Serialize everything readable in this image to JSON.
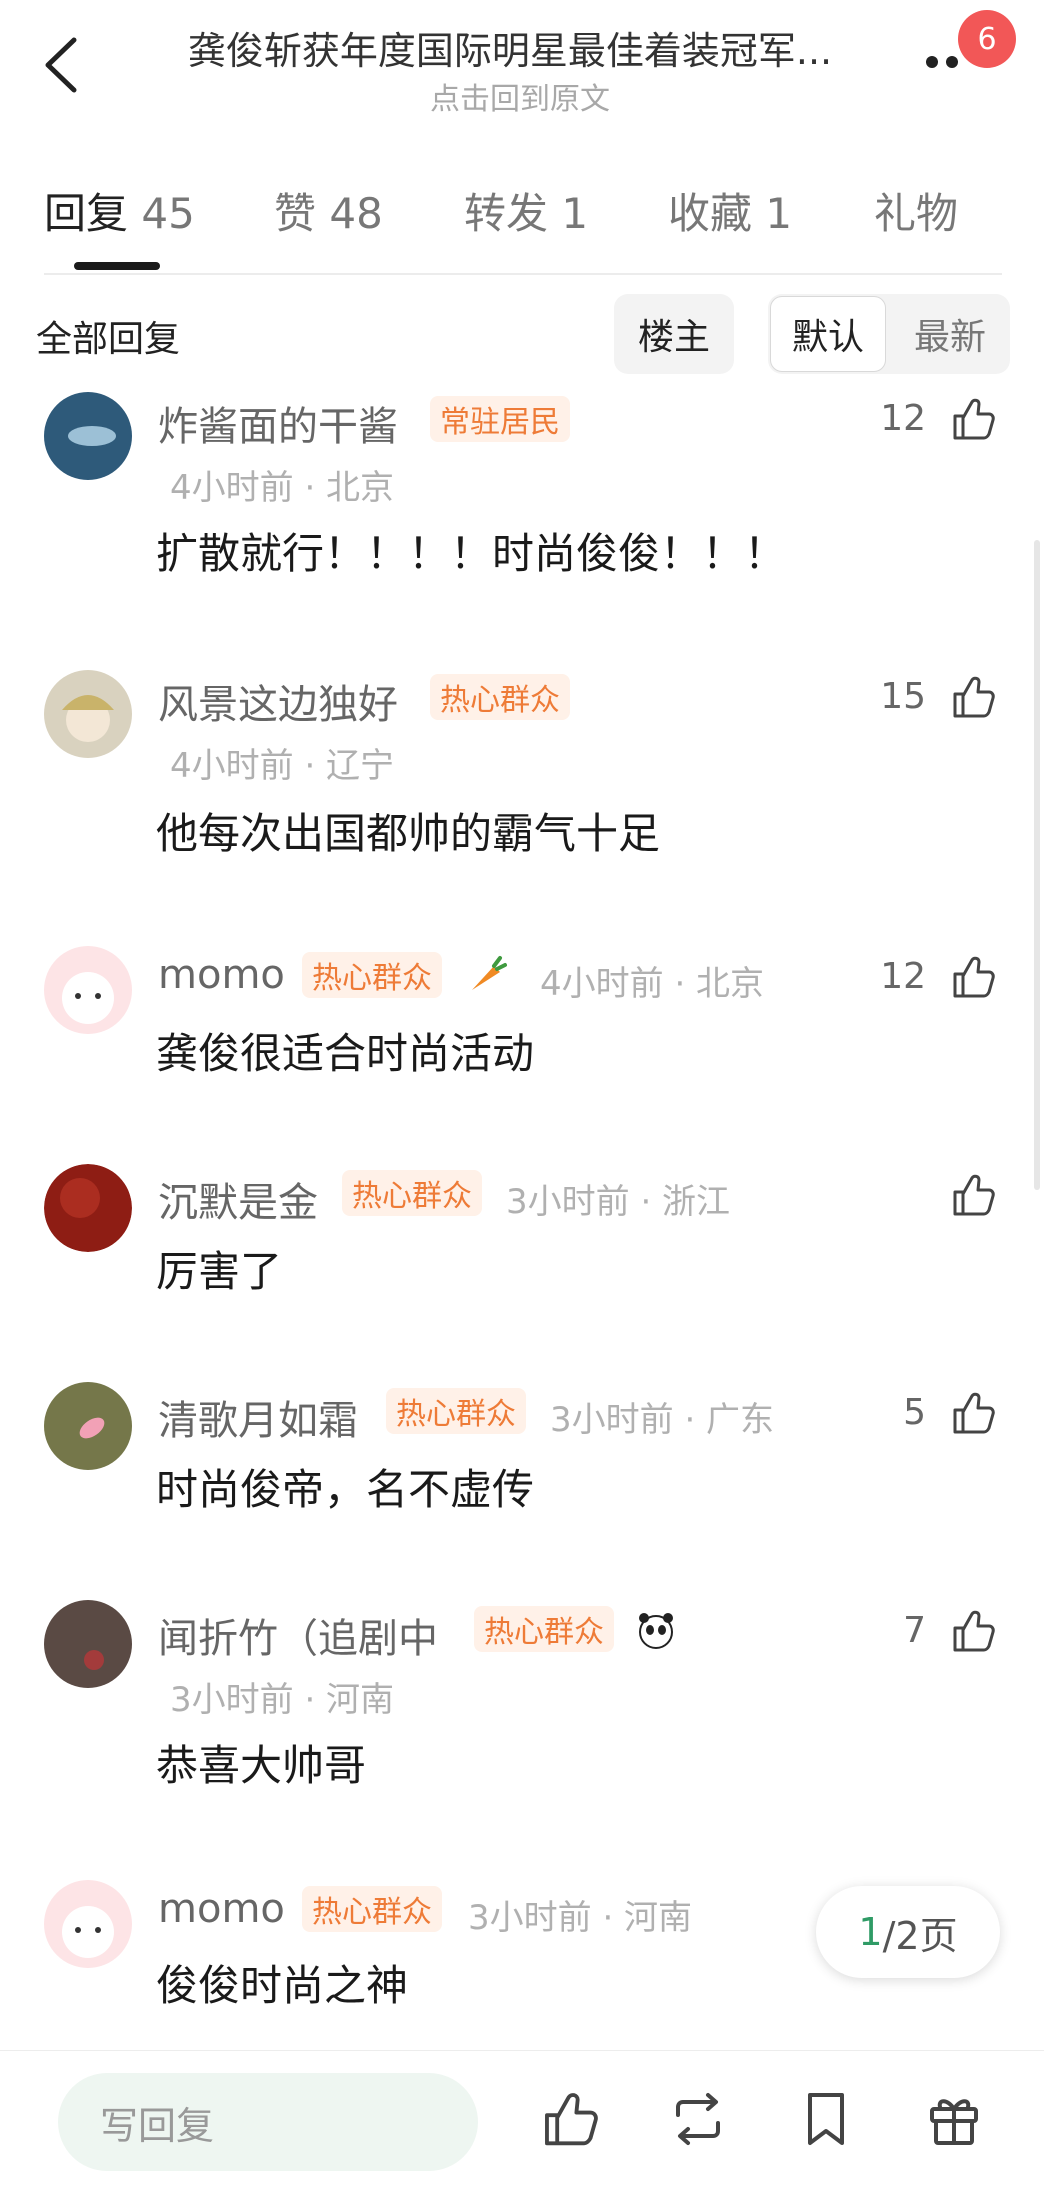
{
  "header": {
    "title": "龚俊斩获年度国际明星最佳着装冠军...",
    "subtitle": "点击回到原文",
    "badge_count": "6",
    "back_icon": "chevron-left-icon",
    "more_icon": "more-dots-icon"
  },
  "tabs": [
    {
      "label": "回复",
      "count": "45"
    },
    {
      "label": "赞",
      "count": "48"
    },
    {
      "label": "转发",
      "count": "1"
    },
    {
      "label": "收藏",
      "count": "1"
    },
    {
      "label": "礼物",
      "count": ""
    }
  ],
  "filter": {
    "label": "全部回复",
    "owner_button": "楼主",
    "sort_default": "默认",
    "sort_latest": "最新"
  },
  "comments": [
    {
      "name": "炸酱面的干酱",
      "tag": "常驻居民",
      "meta": "4小时前 · 北京",
      "content": "扩散就行！！！！时尚俊俊！！！",
      "likes": "12"
    },
    {
      "name": "风景这边独好",
      "tag": "热心群众",
      "meta": "4小时前 · 辽宁",
      "content": "他每次出国都帅的霸气十足",
      "likes": "15"
    },
    {
      "name": "momo",
      "tag": "热心群众",
      "meta": "4小时前 · 北京",
      "content": "龚俊很适合时尚活动",
      "likes": "12",
      "emoji": "carrot-icon"
    },
    {
      "name": "沉默是金",
      "tag": "热心群众",
      "meta": "3小时前 · 浙江",
      "content": "厉害了",
      "likes": ""
    },
    {
      "name": "清歌月如霜",
      "tag": "热心群众",
      "meta": "3小时前 · 广东",
      "content": "时尚俊帝，名不虚传",
      "likes": "5"
    },
    {
      "name": "闻折竹（追剧中",
      "tag": "热心群众",
      "meta": "3小时前 · 河南",
      "content": "恭喜大帅哥",
      "likes": "7",
      "emoji": "panda-icon"
    },
    {
      "name": "momo",
      "tag": "热心群众",
      "meta": "3小时前 · 河南",
      "content": "俊俊时尚之神",
      "likes": ""
    }
  ],
  "pagination": {
    "current": "1",
    "total_label": "/2页"
  },
  "bottom_bar": {
    "reply_placeholder": "写回复",
    "icons": [
      "thumbs-up-icon",
      "repost-icon",
      "bookmark-icon",
      "gift-icon"
    ]
  },
  "colors": {
    "tag_bg": "#fff1e8",
    "tag_text": "#ee7b37",
    "badge": "#f25757",
    "page_accent": "#2f9b66"
  }
}
